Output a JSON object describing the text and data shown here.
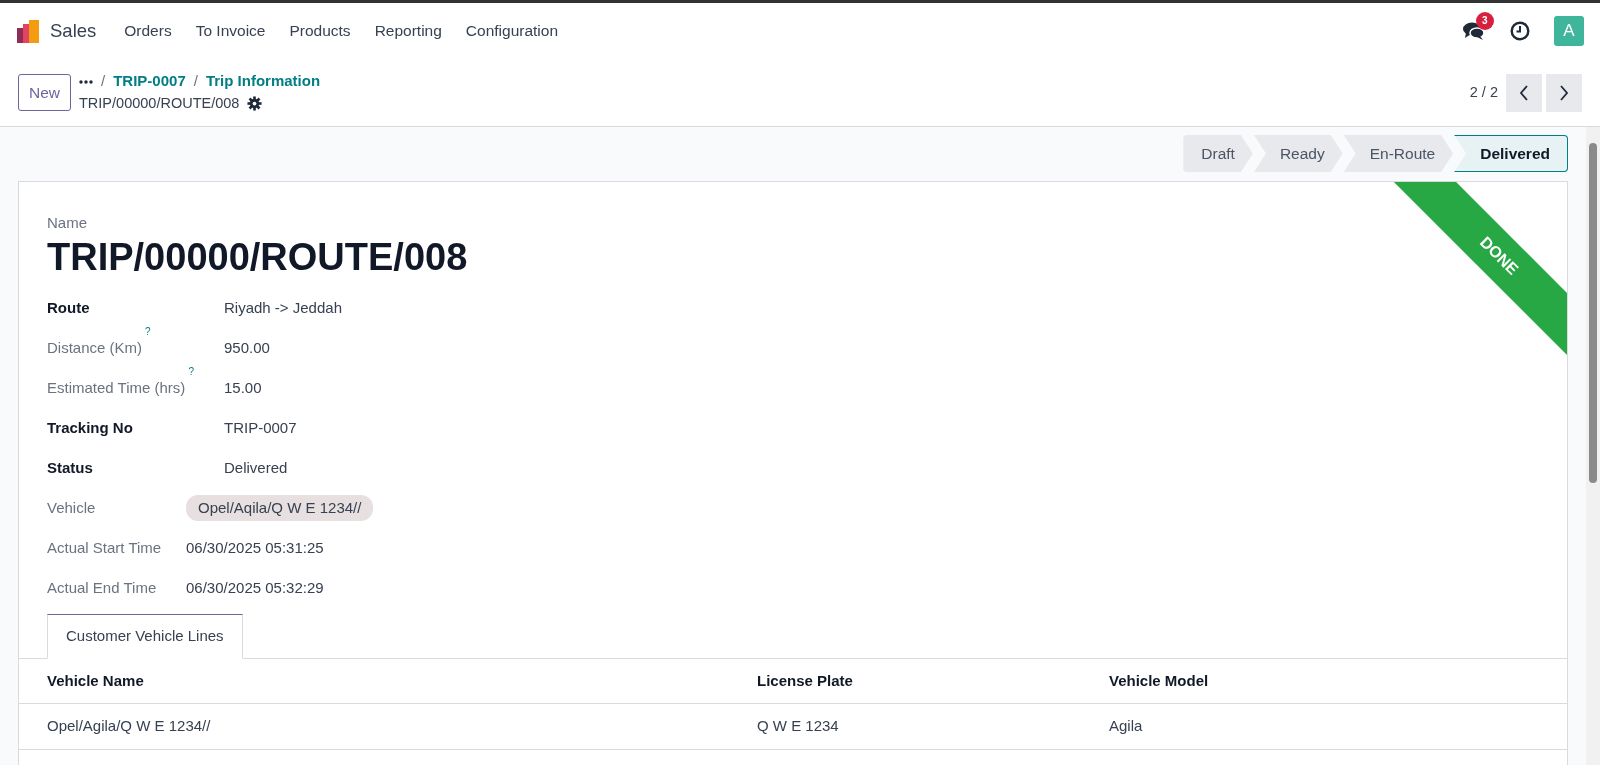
{
  "navbar": {
    "app_name": "Sales",
    "menu": [
      "Orders",
      "To Invoice",
      "Products",
      "Reporting",
      "Configuration"
    ],
    "messages_badge": "3",
    "avatar_letter": "A"
  },
  "control_panel": {
    "new_button": "New",
    "breadcrumbs": [
      {
        "separator": "/",
        "label": "TRIP-0007"
      },
      {
        "separator": "/",
        "label": "Trip Information"
      }
    ],
    "record_name": "TRIP/00000/ROUTE/008",
    "pager": "2 / 2"
  },
  "stages": [
    {
      "label": "Draft",
      "selected": false
    },
    {
      "label": "Ready",
      "selected": false
    },
    {
      "label": "En-Route",
      "selected": false
    },
    {
      "label": "Delivered",
      "selected": true
    }
  ],
  "form": {
    "ribbon": "DONE",
    "name_label": "Name",
    "name": "TRIP/00000/ROUTE/008",
    "groups": [
      {
        "fields": [
          {
            "label": "Route",
            "value": "Riyadh -> Jeddah",
            "required": true,
            "kind": "text"
          },
          {
            "label": "Distance (Km)",
            "help_mark": "?",
            "value": "950.00",
            "required": false,
            "kind": "text"
          },
          {
            "label": "Estimated Time (hrs)",
            "help_mark": "?",
            "value": "15.00",
            "required": false,
            "kind": "text"
          },
          {
            "label": "Tracking No",
            "value": "TRIP-0007",
            "required": true,
            "kind": "text"
          },
          {
            "label": "Status",
            "value": "Delivered",
            "required": true,
            "kind": "text"
          }
        ]
      },
      {
        "fields": [
          {
            "label": "Vehicle",
            "value": "Opel/Aqila/Q W E 1234//",
            "required": false,
            "kind": "tag"
          },
          {
            "label": "Actual Start Time",
            "value": "06/30/2025 05:31:25",
            "required": false,
            "kind": "text"
          },
          {
            "label": "Actual End Time",
            "value": "06/30/2025 05:32:29",
            "required": false,
            "kind": "text"
          }
        ]
      }
    ],
    "tabs": [
      {
        "label": "Customer Vehicle Lines",
        "selected": true
      }
    ],
    "table": {
      "columns": [
        "Vehicle Name",
        "License Plate",
        "Vehicle Model"
      ],
      "rows": [
        [
          "Opel/Agila/Q W E 1234//",
          "Q W E 1234",
          "Agila"
        ]
      ]
    }
  }
}
